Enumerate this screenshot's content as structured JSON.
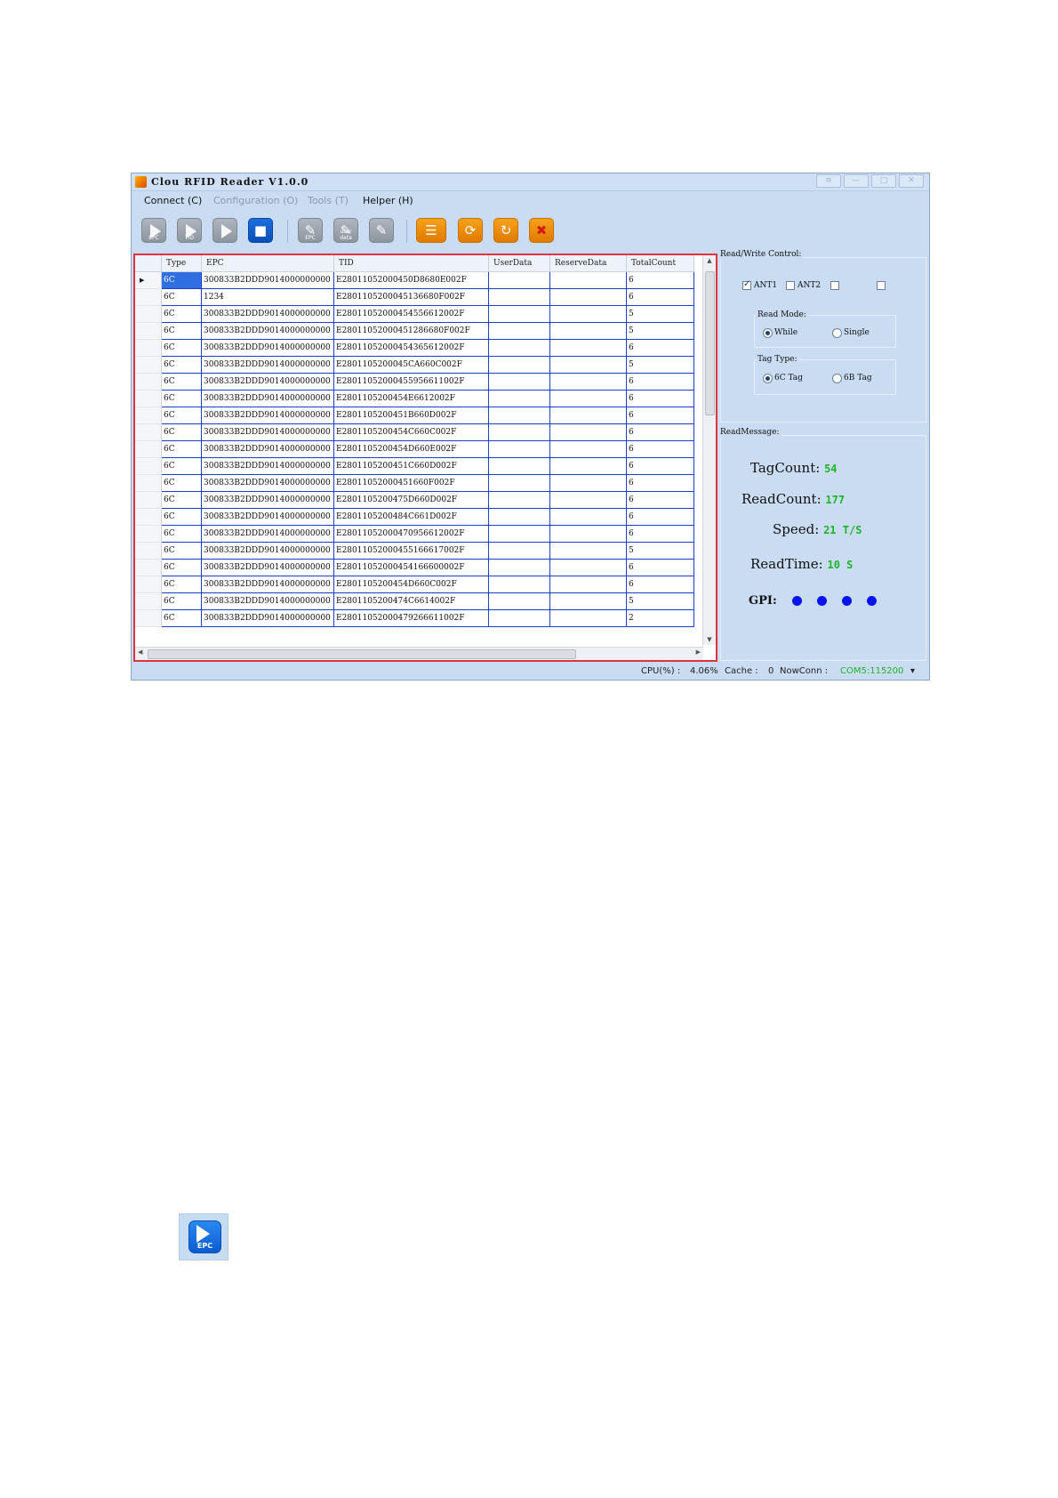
{
  "window": {
    "title": "Clou RFID Reader V1.0.0",
    "controls": [
      "≡",
      "—",
      "□",
      "✕"
    ]
  },
  "menu": [
    {
      "label": "Connect (C)",
      "enabled": true
    },
    {
      "label": "Configuration (O)",
      "enabled": false
    },
    {
      "label": "Tools (T)",
      "enabled": false
    },
    {
      "label": "Helper (H)",
      "enabled": true
    }
  ],
  "toolbar": {
    "read_epc": {
      "icon": "play-epc-icon",
      "sub": "EPC"
    },
    "read_tid": {
      "icon": "play-tid-icon",
      "sub": "TID"
    },
    "read": {
      "icon": "play-icon"
    },
    "stop": {
      "icon": "stop-icon",
      "glyph": "■"
    },
    "write_epc": {
      "icon": "pencil-epc-icon",
      "glyph": "✎",
      "sub": "EPC"
    },
    "write_user": {
      "icon": "pencil-user-icon",
      "glyph": "✎",
      "sub": "user data"
    },
    "write": {
      "icon": "pencil-icon",
      "glyph": "✎"
    },
    "list": {
      "icon": "list-icon",
      "glyph": "☰"
    },
    "refresh": {
      "icon": "refresh-icon",
      "glyph": "⟳"
    },
    "reload": {
      "icon": "reload-icon",
      "glyph": "↻"
    },
    "clear": {
      "icon": "clear-icon",
      "glyph": "✖"
    }
  },
  "table": {
    "columns": [
      "Type",
      "EPC",
      "TID",
      "UserData",
      "ReserveData",
      "TotalCount"
    ],
    "rows": [
      [
        "6C",
        "300833B2DDD9014000000000",
        "E28011052000450D8680E002F",
        "",
        "",
        "6"
      ],
      [
        "6C",
        "1234",
        "E2801105200045136680F002F",
        "",
        "",
        "6"
      ],
      [
        "6C",
        "300833B2DDD9014000000000",
        "E28011052000454556612002F",
        "",
        "",
        "5"
      ],
      [
        "6C",
        "300833B2DDD9014000000000",
        "E28011052000451286680F002F",
        "",
        "",
        "5"
      ],
      [
        "6C",
        "300833B2DDD9014000000000",
        "E28011052000454365612002F",
        "",
        "",
        "6"
      ],
      [
        "6C",
        "300833B2DDD9014000000000",
        "E2801105200045CA660C002F",
        "",
        "",
        "5"
      ],
      [
        "6C",
        "300833B2DDD9014000000000",
        "E28011052000455956611002F",
        "",
        "",
        "6"
      ],
      [
        "6C",
        "300833B2DDD9014000000000",
        "E2801105200454E6612002F",
        "",
        "",
        "6"
      ],
      [
        "6C",
        "300833B2DDD9014000000000",
        "E2801105200451B660D002F",
        "",
        "",
        "6"
      ],
      [
        "6C",
        "300833B2DDD9014000000000",
        "E2801105200454C660C002F",
        "",
        "",
        "6"
      ],
      [
        "6C",
        "300833B2DDD9014000000000",
        "E2801105200454D660E002F",
        "",
        "",
        "6"
      ],
      [
        "6C",
        "300833B2DDD9014000000000",
        "E2801105200451C660D002F",
        "",
        "",
        "6"
      ],
      [
        "6C",
        "300833B2DDD9014000000000",
        "E28011052000451660F002F",
        "",
        "",
        "6"
      ],
      [
        "6C",
        "300833B2DDD9014000000000",
        "E2801105200475D660D002F",
        "",
        "",
        "6"
      ],
      [
        "6C",
        "300833B2DDD9014000000000",
        "E2801105200484C661D002F",
        "",
        "",
        "6"
      ],
      [
        "6C",
        "300833B2DDD9014000000000",
        "E28011052000470956612002F",
        "",
        "",
        "6"
      ],
      [
        "6C",
        "300833B2DDD9014000000000",
        "E28011052000455166617002F",
        "",
        "",
        "5"
      ],
      [
        "6C",
        "300833B2DDD9014000000000",
        "E28011052000454166600002F",
        "",
        "",
        "6"
      ],
      [
        "6C",
        "300833B2DDD9014000000000",
        "E2801105200454D660C002F",
        "",
        "",
        "6"
      ],
      [
        "6C",
        "300833B2DDD9014000000000",
        "E2801105200474C6614002F",
        "",
        "",
        "5"
      ],
      [
        "6C",
        "300833B2DDD9014000000000",
        "E28011052000479266611002F",
        "",
        "",
        "2"
      ]
    ]
  },
  "rw_control": {
    "label": "Read/Write Control:",
    "antennas": [
      {
        "label": "ANT1",
        "checked": true
      },
      {
        "label": "ANT2",
        "checked": false
      },
      {
        "label": "",
        "checked": false
      },
      {
        "label": "",
        "checked": false
      }
    ],
    "read_mode": {
      "label": "Read Mode:",
      "options": [
        "While",
        "Single"
      ],
      "selected": "While"
    },
    "tag_type": {
      "label": "Tag Type:",
      "options": [
        "6C Tag",
        "6B Tag"
      ],
      "selected": "6C Tag"
    }
  },
  "read_message": {
    "label": "ReadMessage:",
    "tag_count_label": "TagCount:",
    "tag_count": "54",
    "read_count_label": "ReadCount:",
    "read_count": "177",
    "speed_label": "Speed:",
    "speed": "21 T/S",
    "read_time_label": "ReadTime:",
    "read_time": "10 S",
    "gpi_label": "GPI:",
    "gpi_color": "#0a14f0"
  },
  "status": {
    "cpu_label": "CPU(%) :",
    "cpu_value": "4.06%",
    "cache_label": "Cache :",
    "cache_value": "0",
    "nowconn_label": "NowConn :",
    "nowconn_value": "COM5:115200",
    "nowconn_color": "#1eb42a"
  },
  "epc_button_large": {
    "icon": "play-epc-icon",
    "label": "EPC"
  },
  "colors": {
    "selection": "#2f6fe1",
    "grid_line": "#1f3ec9",
    "highlight_frame": "#e0333c"
  }
}
